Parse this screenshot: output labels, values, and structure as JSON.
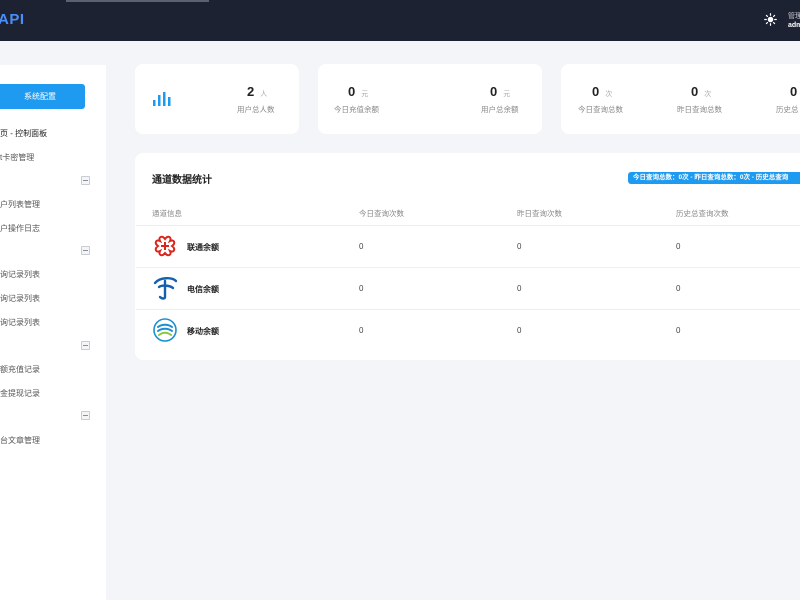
{
  "header": {
    "logo": "API",
    "user_line1": "管理",
    "user_line2": "adm"
  },
  "sidebar": {
    "system_button": "系统配置",
    "items": [
      {
        "label": "页 - 控制面板"
      },
      {
        "label": "t卡密管理"
      },
      {
        "label": "户列表管理"
      },
      {
        "label": "户操作日志"
      },
      {
        "label": "询记录列表"
      },
      {
        "label": "询记录列表"
      },
      {
        "label": "询记录列表"
      },
      {
        "label": "额充值记录"
      },
      {
        "label": "金提现记录"
      },
      {
        "label": "台文章管理"
      }
    ]
  },
  "stats": [
    {
      "value": "2",
      "unit": "人",
      "caption": "用户总人数"
    },
    {
      "value": "0",
      "unit": "元",
      "caption": "今日充值余额"
    },
    {
      "value": "0",
      "unit": "元",
      "caption": "用户总余额"
    },
    {
      "value": "0",
      "unit": "次",
      "caption": "今日查询总数"
    },
    {
      "value": "0",
      "unit": "次",
      "caption": "昨日查询总数"
    },
    {
      "value": "0",
      "unit": "",
      "caption": "历史总"
    }
  ],
  "channel_panel": {
    "title": "通道数据统计",
    "badge": "今日查询总数：0次 - 昨日查询总数：0次 - 历史总查询",
    "columns": [
      "通道信息",
      "今日查询次数",
      "昨日查询次数",
      "历史总查询次数"
    ],
    "rows": [
      {
        "icon": "china-unicom-icon",
        "name": "联通余额",
        "today": "0",
        "yesterday": "0",
        "total": "0"
      },
      {
        "icon": "china-telecom-icon",
        "name": "电信余额",
        "today": "0",
        "yesterday": "0",
        "total": "0"
      },
      {
        "icon": "china-mobile-icon",
        "name": "移动余额",
        "today": "0",
        "yesterday": "0",
        "total": "0"
      }
    ]
  },
  "colors": {
    "topbar": "#1d2233",
    "accent": "#1e9bf0",
    "page_bg": "#f3f5f8",
    "unicom_red": "#d9251c",
    "telecom_blue": "#1560ad",
    "mobile_blue": "#1a8fd1"
  }
}
